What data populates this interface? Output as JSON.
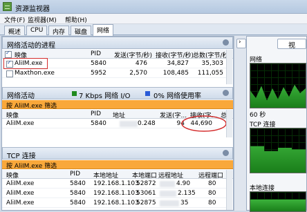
{
  "window": {
    "title": "资源监视器"
  },
  "menu": [
    "文件(F)",
    "监视器(M)",
    "帮助(H)"
  ],
  "tabs": [
    "概述",
    "CPU",
    "内存",
    "磁盘",
    "网络"
  ],
  "processes": {
    "title": "网络活动的进程",
    "columns": [
      "映像",
      "PID",
      "发送(字节/秒)",
      "接收(字节/秒)",
      "总数(字节/秒)"
    ],
    "rows": [
      {
        "name": "AliIM.exe",
        "pid": "5840",
        "send": "476",
        "recv": "34,827",
        "total": "35,303",
        "checked": true
      },
      {
        "name": "Maxthon.exe",
        "pid": "5952",
        "send": "2,570",
        "recv": "108,485",
        "total": "111,055",
        "checked": false
      }
    ]
  },
  "network_activity": {
    "title": "网络活动",
    "io_label": "7 Kbps 网络 I/O",
    "util_label": "0% 网络使用率",
    "filter": "按 AliIM.exe 筛选",
    "columns": [
      "映像",
      "PID",
      "地址",
      "发送(字...",
      "接收(字...",
      "总..."
    ],
    "rows": [
      {
        "name": "AliIM.exe",
        "pid": "5840",
        "addr": "0.248",
        "send": "94",
        "recv": "44,690"
      }
    ]
  },
  "tcp": {
    "title": "TCP 连接",
    "filter": "按 AliIM.exe 筛选",
    "columns": [
      "映像",
      "PID",
      "本地地址",
      "本地端口",
      "远程地址",
      "远程端口"
    ],
    "rows": [
      {
        "name": "AliIM.exe",
        "pid": "5840",
        "laddr": "192.168.1.103",
        "lport": "52872",
        "raddr": "4.90",
        "rport": "80"
      },
      {
        "name": "AliIM.exe",
        "pid": "5840",
        "laddr": "192.168.1.103",
        "lport": "53061",
        "raddr": "2.135",
        "rport": "80"
      },
      {
        "name": "AliIM.exe",
        "pid": "5840",
        "laddr": "192.168.1.103",
        "lport": "52875",
        "raddr": "35",
        "rport": "80"
      }
    ]
  },
  "right_panel": {
    "view_button": "视",
    "graph1_label": "网络",
    "graph1_caption": "60 秒",
    "graph2_label": "TCP 连接",
    "graph3_label": "本地连接"
  }
}
